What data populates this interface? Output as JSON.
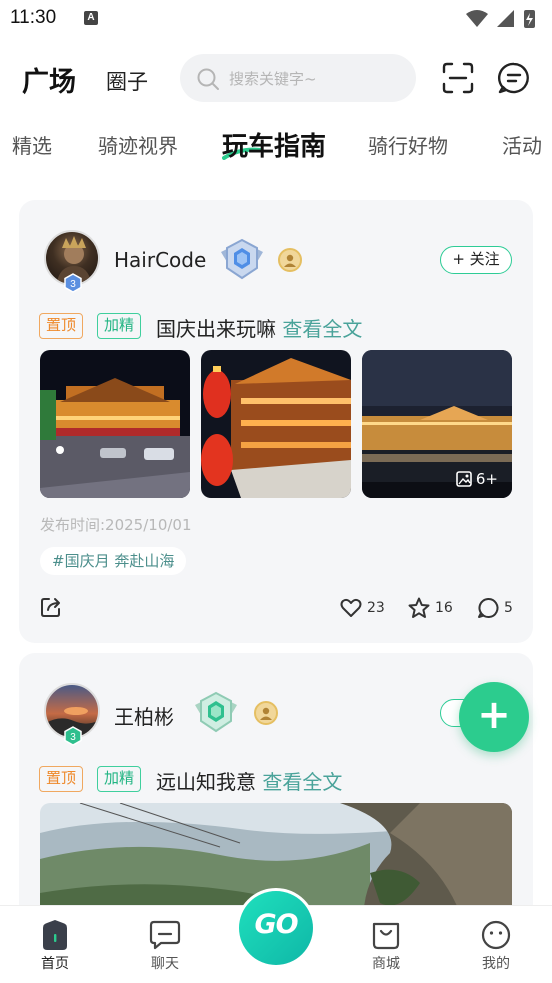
{
  "status_bar": {
    "time": "11:30",
    "notification_glyph": "A"
  },
  "header": {
    "tab_plaza": "广场",
    "tab_circle": "圈子",
    "search_placeholder": "搜索关键字~",
    "icons": [
      "scan-icon",
      "message-icon"
    ]
  },
  "channels": [
    {
      "label": "精选",
      "active": false
    },
    {
      "label": "骑迹视界",
      "active": false
    },
    {
      "label": "玩车指南",
      "active": true
    },
    {
      "label": "骑行好物",
      "active": false
    },
    {
      "label": "活动",
      "active": false
    }
  ],
  "posts": [
    {
      "username": "HairCode",
      "avatar_level": "3",
      "follow_label": "+ 关注",
      "tag_top": "置顶",
      "tag_featured": "加精",
      "title": "国庆出来玩嘛",
      "read_more": "查看全文",
      "more_images": "6+",
      "publish_time": "发布时间:2025/10/01",
      "topic": "#国庆月 奔赴山海",
      "likes": "23",
      "favorites": "16",
      "comments": "5"
    },
    {
      "username": "王柏彬",
      "avatar_level": "3",
      "follow_label": "+",
      "tag_top": "置顶",
      "tag_featured": "加精",
      "title": "远山知我意",
      "read_more": "查看全文"
    }
  ],
  "fab": {
    "label": "+"
  },
  "bottom_nav": {
    "items": [
      {
        "label": "首页",
        "active": true
      },
      {
        "label": "聊天",
        "active": false
      },
      {
        "label": "商城",
        "active": false
      },
      {
        "label": "我的",
        "active": false
      }
    ],
    "center_label": "GO"
  },
  "colors": {
    "accent": "#2ccc8e",
    "tag_orange": "#ee8a2c",
    "link": "#4aa39a"
  }
}
